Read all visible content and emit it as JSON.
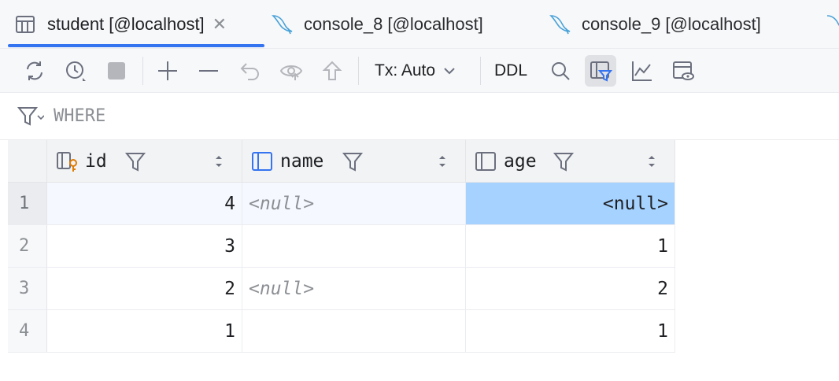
{
  "tabs": [
    {
      "label": "student [@localhost]",
      "icon": "table-icon",
      "active": true
    },
    {
      "label": "console_8 [@localhost]",
      "icon": "mysql-dolphin-icon",
      "active": false
    },
    {
      "label": "console_9 [@localhost]",
      "icon": "mysql-dolphin-icon",
      "active": false
    }
  ],
  "toolbar": {
    "tx_label": "Tx: Auto",
    "ddl_label": "DDL",
    "icons": [
      "refresh-icon",
      "history-icon",
      "stop-icon",
      "add-row-icon",
      "delete-row-icon",
      "revert-icon",
      "preview-changes-icon",
      "submit-icon",
      "search-icon",
      "filter-panel-icon",
      "chart-icon",
      "view-settings-icon"
    ]
  },
  "filter": {
    "placeholder": "WHERE"
  },
  "grid": {
    "columns": [
      {
        "name": "id",
        "icon": "primary-key-column-icon"
      },
      {
        "name": "name",
        "icon": "column-icon"
      },
      {
        "name": "age",
        "icon": "column-icon"
      }
    ],
    "rows": [
      {
        "num": "1",
        "cells": [
          "4",
          "<null>",
          "<null>"
        ]
      },
      {
        "num": "2",
        "cells": [
          "3",
          "",
          "1"
        ]
      },
      {
        "num": "3",
        "cells": [
          "2",
          "<null>",
          "2"
        ]
      },
      {
        "num": "4",
        "cells": [
          "1",
          "",
          "1"
        ]
      }
    ]
  },
  "colors": {
    "accent": "#3574f0",
    "selected_cell": "#a6d2ff",
    "key_icon": "#e07b00"
  }
}
